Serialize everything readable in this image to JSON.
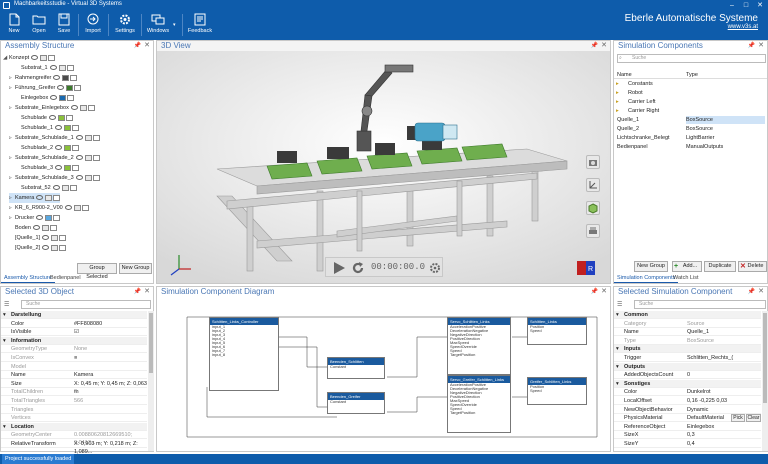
{
  "window": {
    "title": "Machbarkeitsstudie - Virtual 3D Systems"
  },
  "ribbon": {
    "buttons": [
      {
        "label": "New",
        "icon": "new-file-icon"
      },
      {
        "label": "Open",
        "icon": "open-folder-icon"
      },
      {
        "label": "Save",
        "icon": "save-icon"
      },
      {
        "label": "Import",
        "icon": "import-icon"
      },
      {
        "label": "Settings",
        "icon": "gear-icon"
      },
      {
        "label": "Windows",
        "icon": "windows-icon"
      },
      {
        "label": "Feedback",
        "icon": "feedback-icon"
      }
    ],
    "brand_name": "Eberle Automatische Systeme",
    "brand_url": "www.v3s.at"
  },
  "assembly": {
    "title": "Assembly Structure",
    "items": [
      {
        "label": "Konzept",
        "indent": 0,
        "arrow": "◢",
        "color": "#e8e8e8"
      },
      {
        "label": "Substrat_1",
        "indent": 2,
        "arrow": "",
        "color": "#e8e8e8"
      },
      {
        "label": "Rahmengreifer",
        "indent": 1,
        "arrow": "▹",
        "color": "#4a4a4a"
      },
      {
        "label": "Führung_Greifer",
        "indent": 1,
        "arrow": "▹",
        "color": "#3a7a2a"
      },
      {
        "label": "Einlegebox",
        "indent": 2,
        "arrow": "",
        "color": "#1a6ab0"
      },
      {
        "label": "Substrate_Einlegebox",
        "indent": 1,
        "arrow": "▹",
        "color": "#e8e8e8"
      },
      {
        "label": "Schublade",
        "indent": 2,
        "arrow": "",
        "color": "#8ac03a"
      },
      {
        "label": "Schublade_1",
        "indent": 2,
        "arrow": "",
        "color": "#8ac03a"
      },
      {
        "label": "Substrate_Schublade_1",
        "indent": 1,
        "arrow": "▹",
        "color": "#e8e8e8"
      },
      {
        "label": "Schublade_2",
        "indent": 2,
        "arrow": "",
        "color": "#8ac03a"
      },
      {
        "label": "Substrate_Schublade_2",
        "indent": 1,
        "arrow": "▹",
        "color": "#e8e8e8"
      },
      {
        "label": "Schublade_3",
        "indent": 2,
        "arrow": "",
        "color": "#8ac03a"
      },
      {
        "label": "Substrate_Schublade_3",
        "indent": 1,
        "arrow": "▹",
        "color": "#e8e8e8"
      },
      {
        "label": "Substrat_52",
        "indent": 2,
        "arrow": "",
        "color": "#e8e8e8"
      },
      {
        "label": "Kamera",
        "indent": 1,
        "arrow": "▹",
        "color": "#e8e8e8",
        "selected": true
      },
      {
        "label": "KR_6_R900-2_V00",
        "indent": 1,
        "arrow": "▹",
        "color": "#e8e8e8"
      },
      {
        "label": "Drucker",
        "indent": 1,
        "arrow": "▹",
        "color": "#5aa8e0"
      },
      {
        "label": "Boden",
        "indent": 1,
        "arrow": "",
        "color": "#e8e8e8"
      },
      {
        "label": "[Quelle_1]",
        "indent": 1,
        "arrow": "",
        "color": "#e8e8e8"
      },
      {
        "label": "[Quelle_2]",
        "indent": 1,
        "arrow": "",
        "color": "#e8e8e8"
      }
    ],
    "group_selected": "Group Selected",
    "new_group": "New Group",
    "tabs": [
      "Assembly Structure",
      "Bedienpanel"
    ]
  },
  "view3d": {
    "title": "3D View",
    "time": "00:00:00.0"
  },
  "simcomp": {
    "title": "Simulation Components",
    "search_placeholder": "Suche",
    "col_name": "Name",
    "col_type": "Type",
    "rows": [
      {
        "name": "Constants",
        "type": "",
        "group": true
      },
      {
        "name": "Robot",
        "type": "",
        "group": true
      },
      {
        "name": "Carrier Left",
        "type": "",
        "group": true
      },
      {
        "name": "Carrier Right",
        "type": "",
        "group": true
      },
      {
        "name": "Quelle_1",
        "type": "BoxSource",
        "group": false,
        "selected": true
      },
      {
        "name": "Quelle_2",
        "type": "BoxSource",
        "group": false
      },
      {
        "name": "Lichtschranke_Belegt",
        "type": "LightBarrier",
        "group": false
      },
      {
        "name": "Bedienpanel",
        "type": "ManualOutputs",
        "group": false
      }
    ],
    "buttons": [
      "New Group",
      "Add...",
      "Duplicate",
      "Delete"
    ],
    "tabs": [
      "Simulation Components",
      "Watch List"
    ]
  },
  "selected3d": {
    "title": "Selected 3D Object",
    "search_placeholder": "Suche",
    "rows": [
      {
        "k": "Darstellung",
        "v": "",
        "sec": true
      },
      {
        "k": "Color",
        "v": "#FF808080"
      },
      {
        "k": "IsVisible",
        "v": "☑"
      },
      {
        "k": "Information",
        "v": "",
        "sec": true
      },
      {
        "k": "GeometryType",
        "v": "None",
        "dis": true
      },
      {
        "k": "IsConvex",
        "v": "■",
        "dis": true
      },
      {
        "k": "Model",
        "v": "",
        "dis": true
      },
      {
        "k": "Name",
        "v": "Kamera"
      },
      {
        "k": "Size",
        "v": "X: 0,45 m; Y: 0,45 m; Z: 0,063 m"
      },
      {
        "k": "TotalChildren",
        "v": "2",
        "dis": true
      },
      {
        "k": "TotalTriangles",
        "v": "566",
        "dis": true
      },
      {
        "k": "Triangles",
        "v": "",
        "dis": true
      },
      {
        "k": "Vertices",
        "v": "",
        "dis": true
      },
      {
        "k": "Location",
        "v": "",
        "sec": true
      },
      {
        "k": "GeometryCenter",
        "v": "0.00880620812669510; 0.0417...",
        "dis": true
      },
      {
        "k": "RelativeTransform",
        "v": "X: 0,903 m; Y: 0,218 m; Z: 1,089..."
      }
    ]
  },
  "diagram": {
    "title": "Simulation Component Diagram",
    "nodes": [
      {
        "title": "Schlitten_Links_Controller",
        "rows": [
          "input_1",
          "input_2",
          "input_3",
          "input_4",
          "input_5",
          "input_6",
          "input_7",
          "input_8"
        ]
      },
      {
        "title": "Beenden_Schlitten",
        "rows": [
          "Constant"
        ]
      },
      {
        "title": "Beenden_Greifer",
        "rows": [
          "Constant"
        ]
      },
      {
        "title": "Servo_Schlitten_Links",
        "rows": [
          "AccelerationPositive",
          "DecelerationNegative",
          "NegativeDirection",
          "PositiveDirection",
          "MaxSpeed",
          "SpeedOverride",
          "Speed",
          "TargetPosition"
        ]
      },
      {
        "title": "Servo_Greifer_Schlitten_Links",
        "rows": [
          "AccelerationPositive",
          "DecelerationNegative",
          "NegativeDirection",
          "PositiveDirection",
          "MaxSpeed",
          "SpeedOverride",
          "Speed",
          "TargetPosition"
        ]
      },
      {
        "title": "Schlitten_Links",
        "rows": [
          "Position",
          "Speed"
        ]
      },
      {
        "title": "Greifer_Schlitten_Links",
        "rows": [
          "Position",
          "Speed"
        ]
      }
    ]
  },
  "selsim": {
    "title": "Selected Simulation Component",
    "search_placeholder": "Suche",
    "rows": [
      {
        "k": "Common",
        "v": "",
        "sec": true
      },
      {
        "k": "Category",
        "v": "Source",
        "dis": true
      },
      {
        "k": "Name",
        "v": "Quelle_1"
      },
      {
        "k": "Type",
        "v": "BoxSource",
        "dis": true
      },
      {
        "k": "Inputs",
        "v": "",
        "sec": true
      },
      {
        "k": "Trigger",
        "v": "Schlitten_Rechts_("
      },
      {
        "k": "Outputs",
        "v": "",
        "sec": true
      },
      {
        "k": "AddedObjectsCount",
        "v": "0"
      },
      {
        "k": "Sonstiges",
        "v": "",
        "sec": true
      },
      {
        "k": "Color",
        "v": "Dunkelrot"
      },
      {
        "k": "LocalOffset",
        "v": "0,16   -0,225   0,03"
      },
      {
        "k": "NewObjectBehavior",
        "v": "Dynamic"
      },
      {
        "k": "PhysicsMaterial",
        "v": "DefaultMaterial"
      },
      {
        "k": "ReferenceObject",
        "v": "Einlegebox"
      },
      {
        "k": "SizeX",
        "v": "0,3"
      },
      {
        "k": "SizeY",
        "v": "0,4"
      }
    ],
    "pick": "Pick",
    "clear": "Clear"
  },
  "status": {
    "message": "Project successfully loaded"
  }
}
